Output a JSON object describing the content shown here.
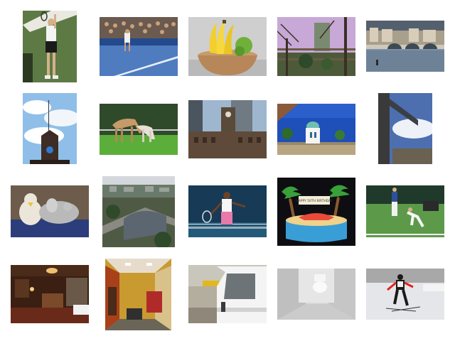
{
  "gallery": {
    "images": [
      {
        "subject": "tennis-player-serving"
      },
      {
        "subject": "tennis-match-stadium"
      },
      {
        "subject": "fruit-bowl-bananas"
      },
      {
        "subject": "trees-and-fence"
      },
      {
        "subject": "river-bridge-city"
      },
      {
        "subject": "clock-tower-cupola-sky"
      },
      {
        "subject": "horses-grazing-field"
      },
      {
        "subject": "clock-tower-skyscraper"
      },
      {
        "subject": "white-domed-building"
      },
      {
        "subject": "street-sign-building"
      },
      {
        "subject": "stuffed-animals-on-bed"
      },
      {
        "subject": "train-station-aerial"
      },
      {
        "subject": "female-tennis-player"
      },
      {
        "subject": "tropical-birthday-cake",
        "caption": "HAPPY 50TH BIRTHDAY"
      },
      {
        "subject": "grass-court-tennis"
      },
      {
        "subject": "restaurant-interior"
      },
      {
        "subject": "shop-interior-bicycle"
      },
      {
        "subject": "white-truck-beach"
      },
      {
        "subject": "small-bathroom-toilet"
      },
      {
        "subject": "cross-country-skier"
      }
    ]
  },
  "colors": {
    "background": "#ffffff"
  }
}
